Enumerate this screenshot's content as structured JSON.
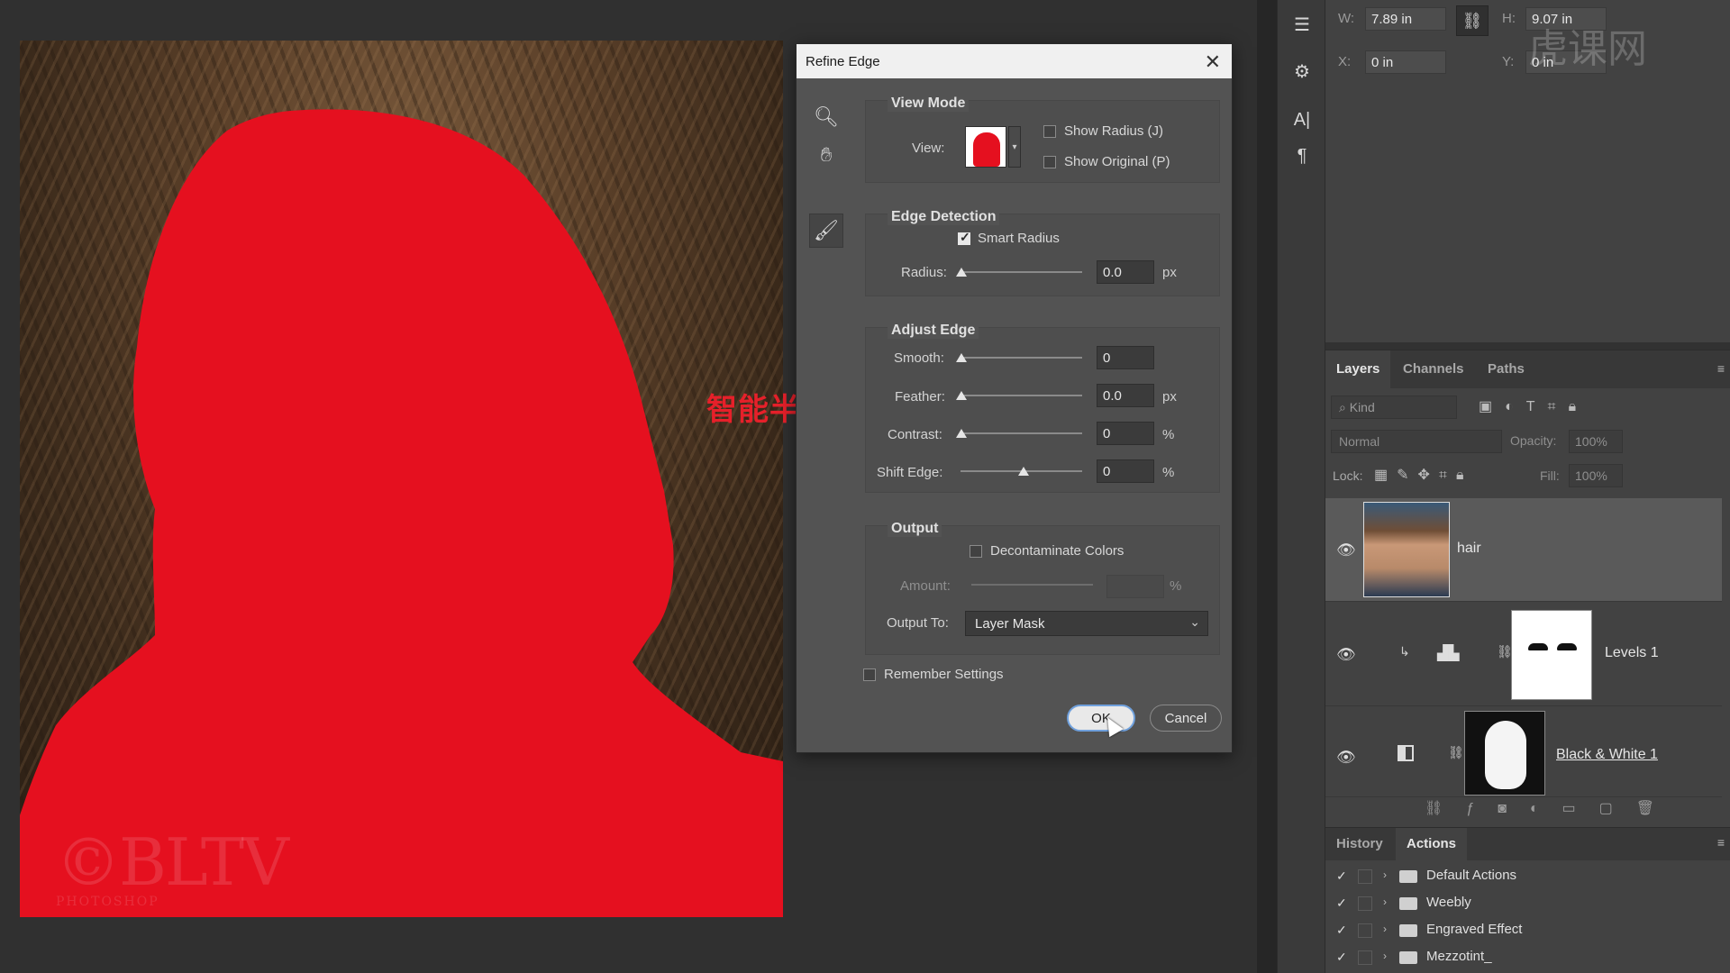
{
  "dialog": {
    "title": "Refine Edge",
    "view_mode": {
      "title": "View Mode",
      "view_label": "View:",
      "show_radius": "Show Radius (J)",
      "show_original": "Show Original (P)"
    },
    "edge_detection": {
      "title": "Edge Detection",
      "smart_radius": "Smart Radius",
      "radius_label": "Radius:",
      "radius_value": "0.0",
      "radius_unit": "px"
    },
    "adjust_edge": {
      "title": "Adjust Edge",
      "smooth_label": "Smooth:",
      "smooth_value": "0",
      "feather_label": "Feather:",
      "feather_value": "0.0",
      "feather_unit": "px",
      "contrast_label": "Contrast:",
      "contrast_value": "0",
      "contrast_unit": "%",
      "shift_label": "Shift Edge:",
      "shift_value": "0",
      "shift_unit": "%"
    },
    "output": {
      "title": "Output",
      "decontaminate": "Decontaminate Colors",
      "amount_label": "Amount:",
      "amount_unit": "%",
      "output_to_label": "Output To:",
      "output_to_value": "Layer Mask"
    },
    "remember": "Remember Settings",
    "ok": "OK",
    "cancel": "Cancel"
  },
  "annotation": {
    "text": "智能半径",
    "color": "#e6202a"
  },
  "canvas": {
    "watermark_big": "©BLTV",
    "watermark_small": "PHOTOSHOP",
    "mask_color": "#e5101f"
  },
  "properties": {
    "w_label": "W:",
    "w_value": "7.89 in",
    "h_label": "H:",
    "h_value": "9.07 in",
    "x_label": "X:",
    "x_value": "0 in",
    "y_label": "Y:",
    "y_value": "0 in",
    "watermark": "虎课网"
  },
  "layers": {
    "tabs": [
      "Layers",
      "Channels",
      "Paths"
    ],
    "kind_placeholder": "Kind",
    "blend_mode": "Normal",
    "opacity_label": "Opacity:",
    "opacity_value": "100%",
    "lock_label": "Lock:",
    "fill_label": "Fill:",
    "fill_value": "100%",
    "items": [
      {
        "name": "hair"
      },
      {
        "name": "Levels 1"
      },
      {
        "name": "Black & White 1"
      }
    ]
  },
  "history": {
    "tabs": [
      "History",
      "Actions"
    ],
    "actions": [
      "Default Actions",
      "Weebly",
      "Engraved Effect",
      "Mezzotint_"
    ]
  }
}
